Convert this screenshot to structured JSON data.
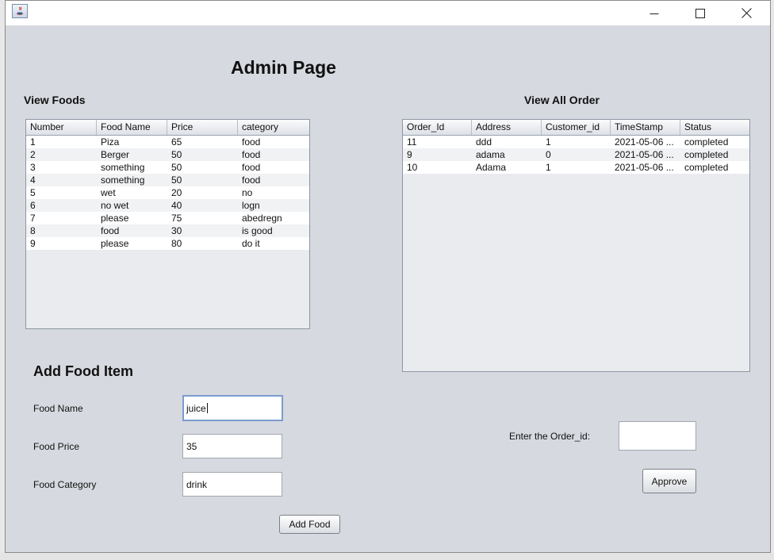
{
  "window": {
    "title": ""
  },
  "page_title": "Admin Page",
  "foods": {
    "heading": "View Foods",
    "columns": [
      "Number",
      "Food Name",
      "Price",
      "category"
    ],
    "rows": [
      [
        "1",
        "Piza",
        "65",
        "food"
      ],
      [
        "2",
        "Berger",
        "50",
        "food"
      ],
      [
        "3",
        "something",
        "50",
        "food"
      ],
      [
        "4",
        "something",
        "50",
        "food"
      ],
      [
        "5",
        "wet",
        "20",
        "no"
      ],
      [
        "6",
        "no wet",
        "40",
        "logn"
      ],
      [
        "7",
        "please",
        "75",
        "abedregn"
      ],
      [
        "8",
        "food",
        "30",
        "is good"
      ],
      [
        "9",
        "please",
        "80",
        "do it"
      ]
    ]
  },
  "orders": {
    "heading": "View All Order",
    "columns": [
      "Order_Id",
      "Address",
      "Customer_id",
      "TimeStamp",
      "Status"
    ],
    "rows": [
      [
        "11",
        "ddd",
        "1",
        "2021-05-06 ...",
        "completed"
      ],
      [
        "9",
        "adama",
        "0",
        "2021-05-06 ...",
        "completed"
      ],
      [
        "10",
        "Adama",
        "1",
        "2021-05-06 ...",
        "completed"
      ]
    ]
  },
  "add_food": {
    "heading": "Add Food Item",
    "name_label": "Food Name",
    "name_value": "juice",
    "price_label": "Food Price",
    "price_value": "35",
    "category_label": "Food Category",
    "category_value": "drink",
    "submit_label": "Add Food"
  },
  "approve": {
    "label": "Enter the Order_id:",
    "value": "",
    "button_label": "Approve"
  },
  "colors": {
    "window_bg": "#d6d9df",
    "focus_border": "#7b9ccf"
  }
}
